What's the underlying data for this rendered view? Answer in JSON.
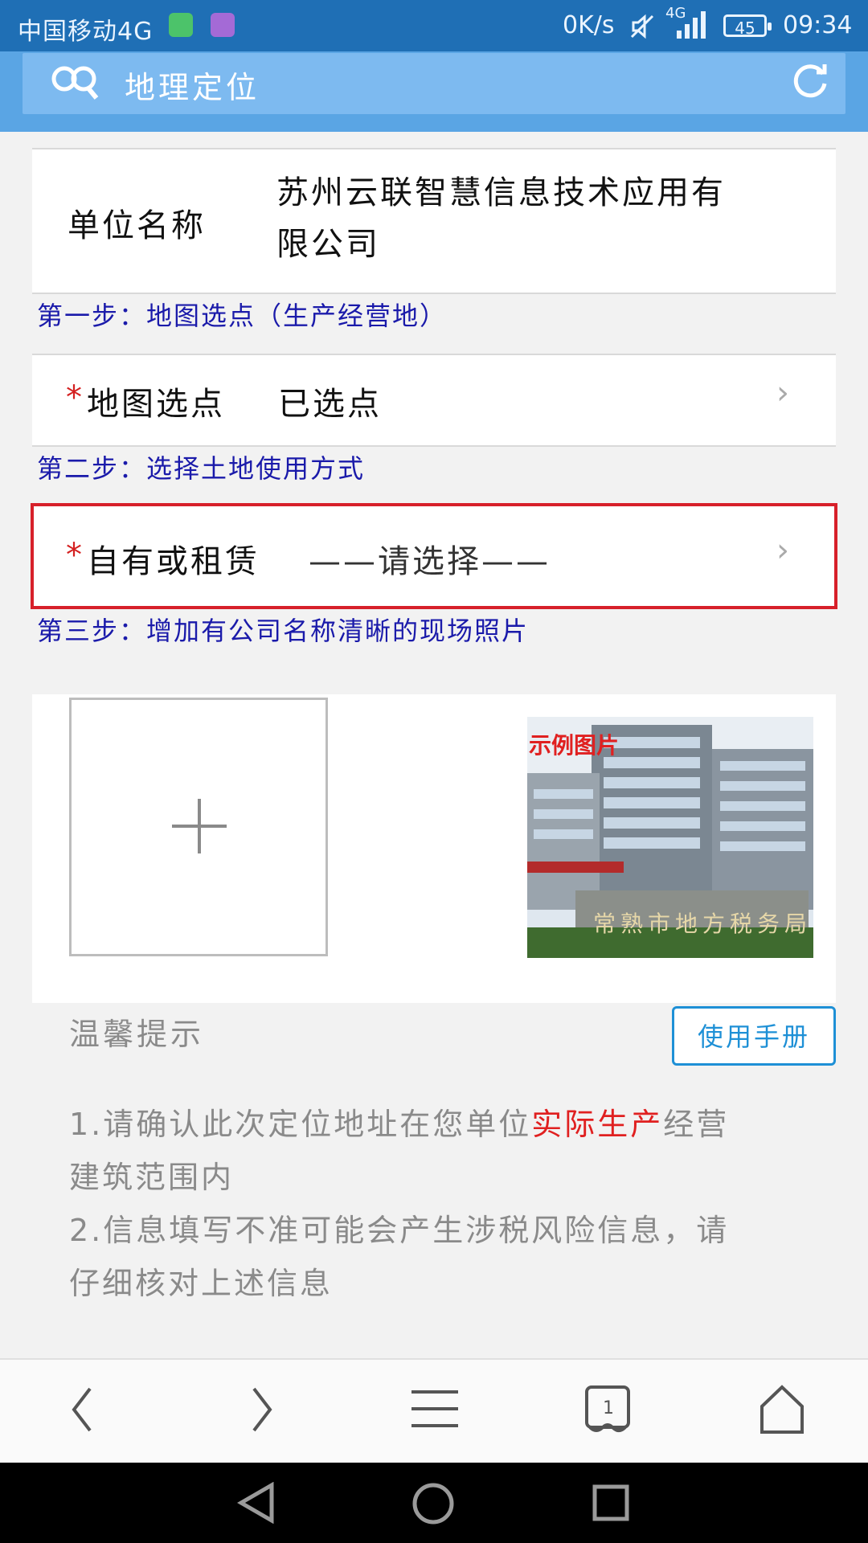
{
  "status_bar": {
    "carrier": "中国移动4G",
    "speed": "0K/s",
    "network": "4G",
    "battery": "45",
    "time": "09:34"
  },
  "header": {
    "title": "地理定位",
    "logo_icon": "binoculars-icon",
    "refresh_icon": "refresh-icon"
  },
  "form": {
    "company_label": "单位名称",
    "company_value_line1": "苏州云联智慧信息技术应用有",
    "company_value_line2": "限公司",
    "step1": "第一步：地图选点（生产经营地）",
    "map_label": "地图选点",
    "map_value": "已选点",
    "step2": "第二步：选择土地使用方式",
    "land_label": "自有或租赁",
    "land_value": "——请选择——",
    "step3": "第三步：增加有公司名称清晰的现场照片",
    "required_mark": "*"
  },
  "photo": {
    "example_label": "示例图片",
    "example_sign": "常熟市地方税务局"
  },
  "hints": {
    "title": "温馨提示",
    "manual_button": "使用手册",
    "tip1_part1": "1.请确认此次定位地址在您单位",
    "tip1_highlight": "实际生产",
    "tip1_part2": "经营",
    "tip1_line2": "建筑范围内",
    "tip2_line1": "2.信息填写不准可能会产生涉税风险信息，请",
    "tip2_line2": "仔细核对上述信息"
  },
  "browser_nav": {
    "tab_count": "1"
  },
  "colors": {
    "header": "#5aa5e4",
    "status_bar": "#1f6fb5",
    "step_text": "#1a1aaa",
    "highlight_border": "#d7202a",
    "accent": "#1e90d6"
  }
}
